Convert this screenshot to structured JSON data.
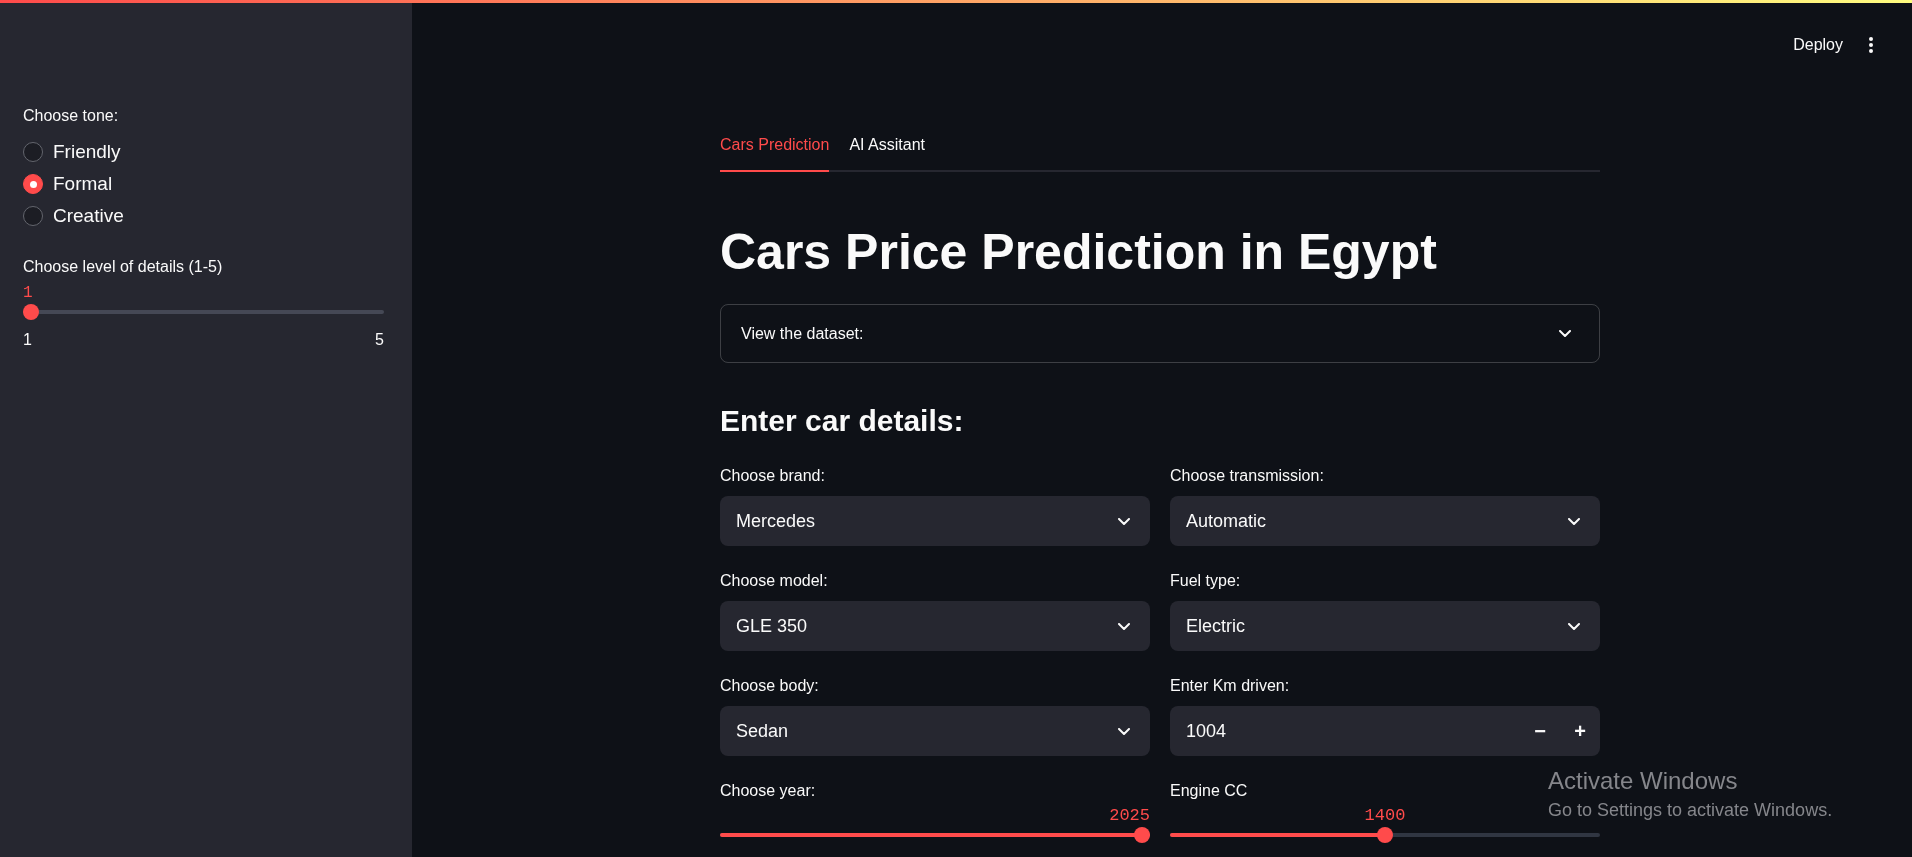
{
  "sidebar": {
    "tone": {
      "label": "Choose tone:",
      "options": [
        {
          "label": "Friendly",
          "selected": false
        },
        {
          "label": "Formal",
          "selected": true
        },
        {
          "label": "Creative",
          "selected": false
        }
      ]
    },
    "detail": {
      "label": "Choose level of details (1-5)",
      "value": "1",
      "level": 0,
      "min": "1",
      "max": "5"
    }
  },
  "header": {
    "deploy": "Deploy"
  },
  "tabs": [
    {
      "label": "Cars Prediction",
      "selected": true
    },
    {
      "label": "AI Assitant",
      "selected": false
    }
  ],
  "title": "Cars Price Prediction in Egypt",
  "expander": {
    "label": "View the dataset:",
    "expanded": false
  },
  "section_heading": "Enter car details:",
  "fields": [
    {
      "kind": "select",
      "label": "Choose brand:",
      "value": "Mercedes"
    },
    {
      "kind": "select",
      "label": "Choose transmission:",
      "value": "Automatic"
    },
    {
      "kind": "select",
      "label": "Choose model:",
      "value": "GLE 350"
    },
    {
      "kind": "select",
      "label": "Fuel type:",
      "value": "Electric"
    },
    {
      "kind": "select",
      "label": "Choose body:",
      "value": "Sedan"
    },
    {
      "kind": "number",
      "label": "Enter Km driven:",
      "value": "1004",
      "decrement": "−",
      "increment": "+"
    },
    {
      "kind": "slider",
      "label": "Choose year:",
      "value": "2025",
      "level": 1
    },
    {
      "kind": "slider",
      "label": "Engine CC",
      "value": "1400",
      "level": 0.5
    }
  ],
  "os_notice": {
    "title": "Activate Windows",
    "text": "Go to Settings to activate Windows."
  }
}
